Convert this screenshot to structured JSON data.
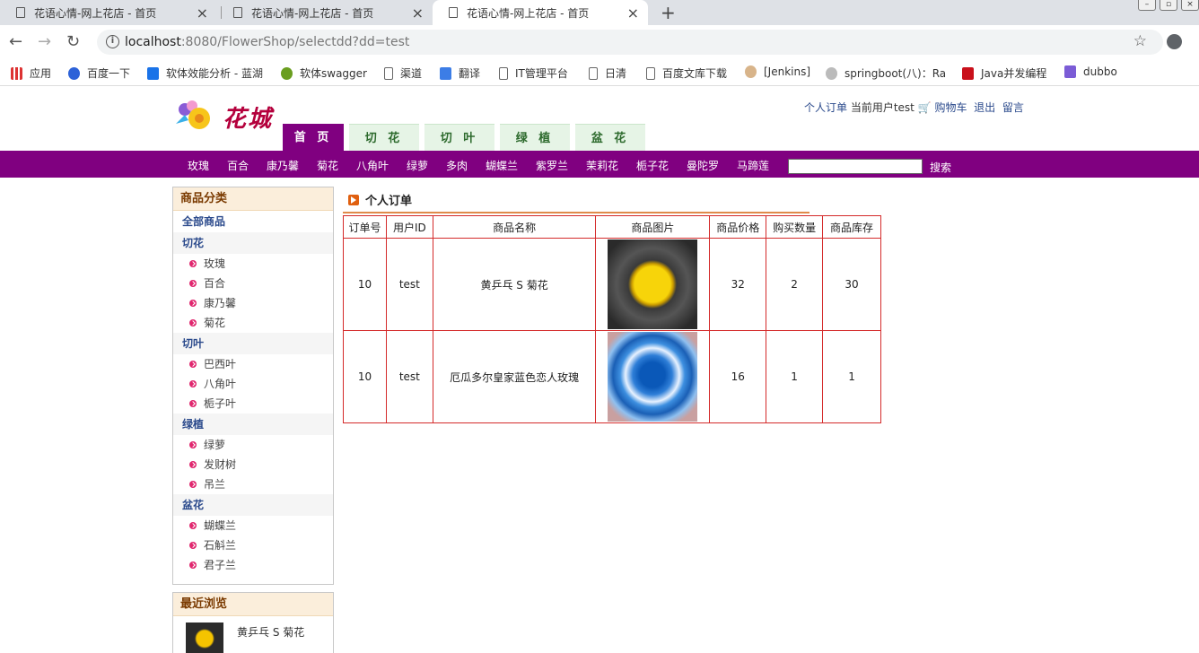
{
  "browser": {
    "tabs": [
      {
        "title": "花语心情-网上花店 - 首页"
      },
      {
        "title": "花语心情-网上花店 - 首页"
      },
      {
        "title": "花语心情-网上花店 - 首页"
      }
    ],
    "url_host": "localhost",
    "url_rest": ":8080/FlowerShop/selectdd?dd=test",
    "bookmarks": [
      "应用",
      "百度一下",
      "软体效能分析 - 蓝湖",
      "软体swagger",
      "渠道",
      "翻译",
      "IT管理平台",
      "日清",
      "百度文库下载",
      "[Jenkins]",
      "springboot(八)：Ra",
      "Java并发编程",
      "dubbo"
    ]
  },
  "header": {
    "brand": "花城",
    "links": {
      "orders": "个人订单",
      "current_user": "当前用户test",
      "cart": "购物车",
      "logout": "退出",
      "message": "留言"
    },
    "main_tabs": [
      "首 页",
      "切 花",
      "切 叶",
      "绿 植",
      "盆 花"
    ],
    "categories": [
      "玫瑰",
      "百合",
      "康乃馨",
      "菊花",
      "八角叶",
      "绿萝",
      "多肉",
      "蝴蝶兰",
      "紫罗兰",
      "茉莉花",
      "栀子花",
      "曼陀罗",
      "马蹄莲"
    ],
    "search_button": "搜索",
    "search_value": ""
  },
  "sidebar": {
    "title": "商品分类",
    "all": "全部商品",
    "groups": [
      {
        "name": "切花",
        "items": [
          "玫瑰",
          "百合",
          "康乃馨",
          "菊花"
        ]
      },
      {
        "name": "切叶",
        "items": [
          "巴西叶",
          "八角叶",
          "栀子叶"
        ]
      },
      {
        "name": "绿植",
        "items": [
          "绿萝",
          "发财树",
          "吊兰"
        ]
      },
      {
        "name": "盆花",
        "items": [
          "蝴蝶兰",
          "石斛兰",
          "君子兰"
        ]
      }
    ],
    "recent_title": "最近浏览",
    "recent_item": "黄乒乓 S 菊花"
  },
  "orders": {
    "title": "个人订单",
    "columns": [
      "订单号",
      "用户ID",
      "商品名称",
      "商品图片",
      "商品价格",
      "购买数量",
      "商品库存"
    ],
    "rows": [
      {
        "order_no": "10",
        "user_id": "test",
        "name": "黄乒乓 S 菊花",
        "image": "yellow-chrysanthemum",
        "price": "32",
        "qty": "2",
        "stock": "30"
      },
      {
        "order_no": "10",
        "user_id": "test",
        "name": "厄瓜多尔皇家蓝色恋人玫瑰",
        "image": "blue-rose",
        "price": "16",
        "qty": "1",
        "stock": "1"
      }
    ]
  }
}
